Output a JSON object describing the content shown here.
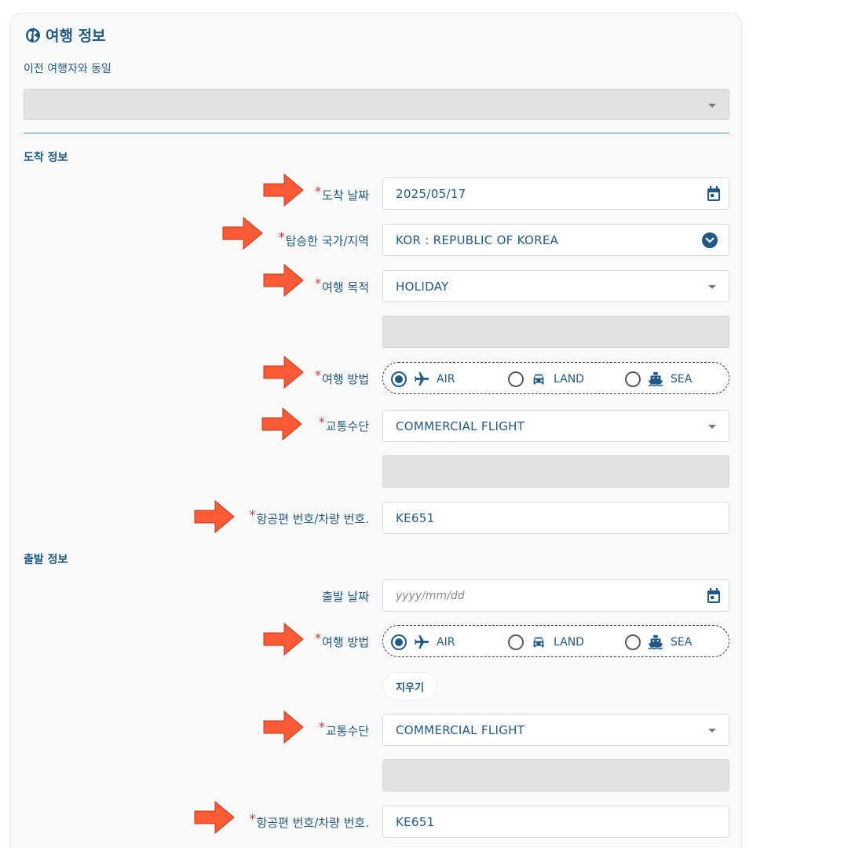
{
  "title": "여행 정보",
  "same_as_previous": {
    "label": "이전 여행자와 동일"
  },
  "arrival": {
    "heading": "도착 정보",
    "date": {
      "label": "도착 날짜",
      "value": "2025/05/17"
    },
    "country": {
      "label": "탑승한 국가/지역",
      "value": "KOR : REPUBLIC OF KOREA"
    },
    "purpose": {
      "label": "여행 목적",
      "value": "HOLIDAY"
    },
    "method": {
      "label": "여행 방법",
      "options": [
        "AIR",
        "LAND",
        "SEA"
      ],
      "selected": "AIR"
    },
    "transport": {
      "label": "교통수단",
      "value": "COMMERCIAL FLIGHT"
    },
    "flight": {
      "label": "항공편 번호/차량 번호.",
      "value": "KE651"
    }
  },
  "departure": {
    "heading": "출발 정보",
    "date": {
      "label": "출발 날짜",
      "placeholder": "yyyy/mm/dd"
    },
    "method": {
      "label": "여행 방법",
      "options": [
        "AIR",
        "LAND",
        "SEA"
      ],
      "selected": "AIR"
    },
    "clear_label": "지우기",
    "transport": {
      "label": "교통수단",
      "value": "COMMERCIAL FLIGHT"
    },
    "flight": {
      "label": "항공편 번호/차량 번호.",
      "value": "KE651"
    }
  },
  "required_mark": "*",
  "colors": {
    "primary": "#1e5a85",
    "required": "#e03131",
    "arrow": "#ff5a36",
    "disabled": "#e2e2e2"
  },
  "icons": [
    "globe-icon",
    "calendar-icon",
    "chevron-circle-icon",
    "plane-icon",
    "car-icon",
    "ship-icon",
    "arrow-annotation"
  ]
}
